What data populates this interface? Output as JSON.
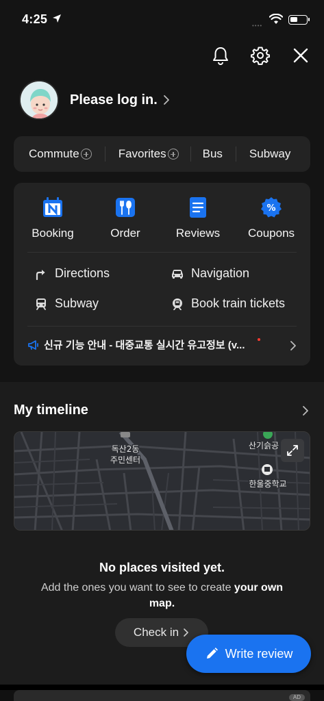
{
  "status_bar": {
    "time": "4:25"
  },
  "header": {
    "icons": [
      "bell-icon",
      "gear-icon",
      "close-icon"
    ]
  },
  "profile": {
    "login_text": "Please log in."
  },
  "quick_tabs": [
    {
      "label": "Commute",
      "has_plus": true
    },
    {
      "label": "Favorites",
      "has_plus": true
    },
    {
      "label": "Bus",
      "has_plus": false
    },
    {
      "label": "Subway",
      "has_plus": false
    }
  ],
  "services": [
    {
      "label": "Booking",
      "icon": "booking-icon"
    },
    {
      "label": "Order",
      "icon": "order-icon"
    },
    {
      "label": "Reviews",
      "icon": "reviews-icon"
    },
    {
      "label": "Coupons",
      "icon": "coupons-icon"
    }
  ],
  "links": [
    {
      "label": "Directions",
      "icon": "directions-icon"
    },
    {
      "label": "Navigation",
      "icon": "car-icon"
    },
    {
      "label": "Subway",
      "icon": "subway-icon"
    },
    {
      "label": "Book train tickets",
      "icon": "train-icon"
    }
  ],
  "notice": {
    "text": "신규 기능 안내 - 대중교통 실시간 유고정보 (v...",
    "icon": "megaphone-icon"
  },
  "timeline": {
    "title": "My timeline",
    "map_labels": [
      "독산2동",
      "주민센터",
      "산기슭공",
      "한울중학교"
    ],
    "empty_title": "No places visited yet.",
    "empty_desc_plain": "Add the ones you want to see to create ",
    "empty_desc_bold": "your own map.",
    "checkin_label": "Check in"
  },
  "fab": {
    "label": "Write review"
  },
  "ad": {
    "label": "AD"
  },
  "colors": {
    "accent": "#1a73f0",
    "background": "#141414",
    "card": "#232323"
  }
}
